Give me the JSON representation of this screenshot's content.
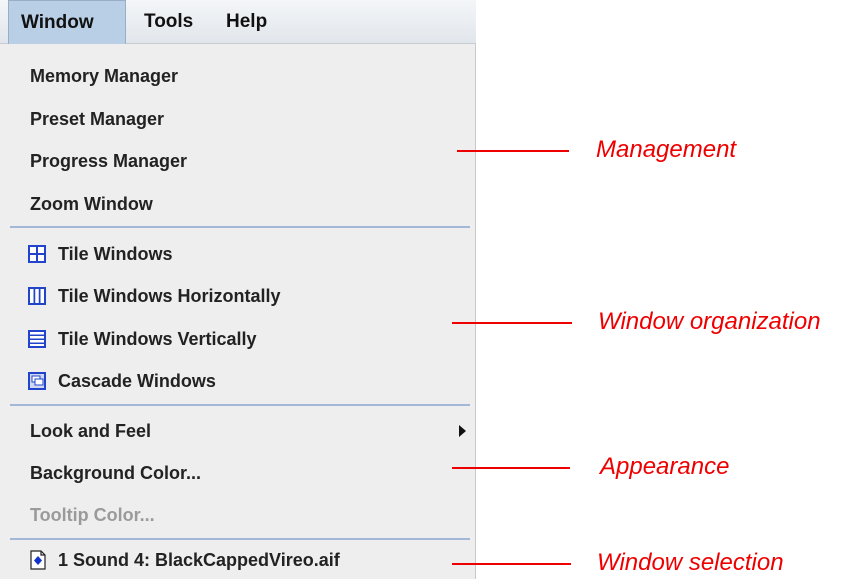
{
  "menubar": {
    "items": [
      {
        "label": "Window",
        "state": "open"
      },
      {
        "label": "Tools"
      },
      {
        "label": "Help"
      }
    ]
  },
  "menu": {
    "groups": [
      {
        "name": "management",
        "items": [
          {
            "label": "Memory Manager"
          },
          {
            "label": "Preset Manager"
          },
          {
            "label": "Progress Manager"
          },
          {
            "label": "Zoom Window"
          }
        ]
      },
      {
        "name": "window-organization",
        "items": [
          {
            "label": "Tile Windows",
            "icon": "tile-windows-icon"
          },
          {
            "label": "Tile Windows Horizontally",
            "icon": "tile-horizontal-icon"
          },
          {
            "label": "Tile Windows Vertically",
            "icon": "tile-vertical-icon"
          },
          {
            "label": "Cascade Windows",
            "icon": "cascade-windows-icon"
          }
        ]
      },
      {
        "name": "appearance",
        "items": [
          {
            "label": "Look and Feel",
            "submenu": true,
            "submenu_icon": "chevron-right-icon"
          },
          {
            "label": "Background Color..."
          },
          {
            "label": "Tooltip Color...",
            "disabled": true
          }
        ]
      },
      {
        "name": "window-selection",
        "items": [
          {
            "label": "1 Sound 4: BlackCappedVireo.aif",
            "icon": "sound-window-icon"
          }
        ]
      }
    ]
  },
  "annotations": [
    {
      "text": "Management"
    },
    {
      "text": "Window organization"
    },
    {
      "text": "Appearance"
    },
    {
      "text": "Window selection"
    }
  ],
  "colors": {
    "annotation": "#ee0000",
    "menu_background": "#eeeeee",
    "separator": "#a3b8d6",
    "icon_blue": "#2244cc",
    "active_menu": "#b8cfe5"
  }
}
